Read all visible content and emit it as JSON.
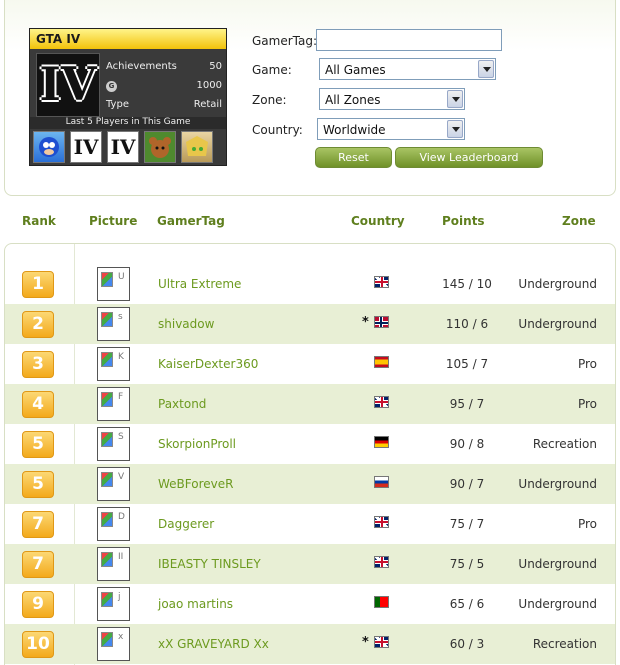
{
  "game_card": {
    "title": "GTA IV",
    "logo_text": "IV",
    "achievements_label": "Achievements",
    "achievements_value": "50",
    "gamerscore_icon": "G",
    "gamerscore_value": "1000",
    "type_label": "Type",
    "type_value": "Retail",
    "last_players_label": "Last 5 Players in This Game",
    "thumb_iv_text": "IV"
  },
  "form": {
    "gamertag_label": "GamerTag:",
    "gamertag_value": "",
    "game_label": "Game:",
    "game_selected": "All Games",
    "zone_label": "Zone:",
    "zone_selected": "All Zones",
    "country_label": "Country:",
    "country_selected": "Worldwide",
    "reset_label": "Reset",
    "leaderboard_label": "View Leaderboard"
  },
  "columns": {
    "rank": "Rank",
    "picture": "Picture",
    "gamertag": "GamerTag",
    "country": "Country",
    "points": "Points",
    "zone": "Zone"
  },
  "rows": [
    {
      "rank": "1",
      "pic_alt": "U",
      "gamertag": "Ultra Extreme",
      "asterisk": "",
      "flag": "uk",
      "points": "145 / 10",
      "zone": "Underground"
    },
    {
      "rank": "2",
      "pic_alt": "s",
      "gamertag": "shivadow",
      "asterisk": "*",
      "flag": "no",
      "points": "110 / 6",
      "zone": "Underground"
    },
    {
      "rank": "3",
      "pic_alt": "K",
      "gamertag": "KaiserDexter360",
      "asterisk": "",
      "flag": "es",
      "points": "105 / 7",
      "zone": "Pro"
    },
    {
      "rank": "4",
      "pic_alt": "F",
      "gamertag": "Paxtond",
      "asterisk": "",
      "flag": "uk",
      "points": "95 / 7",
      "zone": "Pro"
    },
    {
      "rank": "5",
      "pic_alt": "S",
      "gamertag": "SkorpionProll",
      "asterisk": "",
      "flag": "de",
      "points": "90 / 8",
      "zone": "Recreation"
    },
    {
      "rank": "5",
      "pic_alt": "V",
      "gamertag": "WeBForeveR",
      "asterisk": "",
      "flag": "ru",
      "points": "90 / 7",
      "zone": "Underground"
    },
    {
      "rank": "7",
      "pic_alt": "D",
      "gamertag": "Daggerer",
      "asterisk": "",
      "flag": "uk",
      "points": "75 / 7",
      "zone": "Pro"
    },
    {
      "rank": "7",
      "pic_alt": "II",
      "gamertag": "IBEASTY TINSLEY",
      "asterisk": "",
      "flag": "uk",
      "points": "75 / 5",
      "zone": "Underground"
    },
    {
      "rank": "9",
      "pic_alt": "j",
      "gamertag": "joao martins",
      "asterisk": "",
      "flag": "pt",
      "points": "65 / 6",
      "zone": "Underground"
    },
    {
      "rank": "10",
      "pic_alt": "x",
      "gamertag": "xX GRAVEYARD Xx",
      "asterisk": "*",
      "flag": "uk",
      "points": "60 / 3",
      "zone": "Recreation"
    }
  ]
}
